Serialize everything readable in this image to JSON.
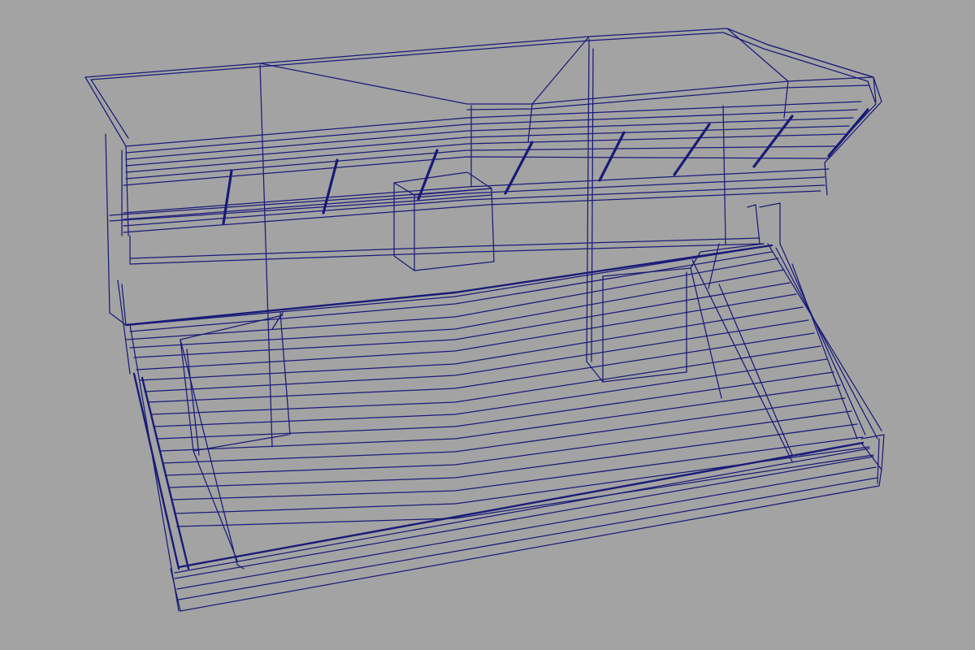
{
  "viewport": {
    "background": "#a3a3a3",
    "wire_color": "#1a1a78",
    "render_mode": "wireframe",
    "subject": "building-model"
  },
  "model": {
    "roof_fin_count": 8,
    "deck_plank_count": 12
  }
}
